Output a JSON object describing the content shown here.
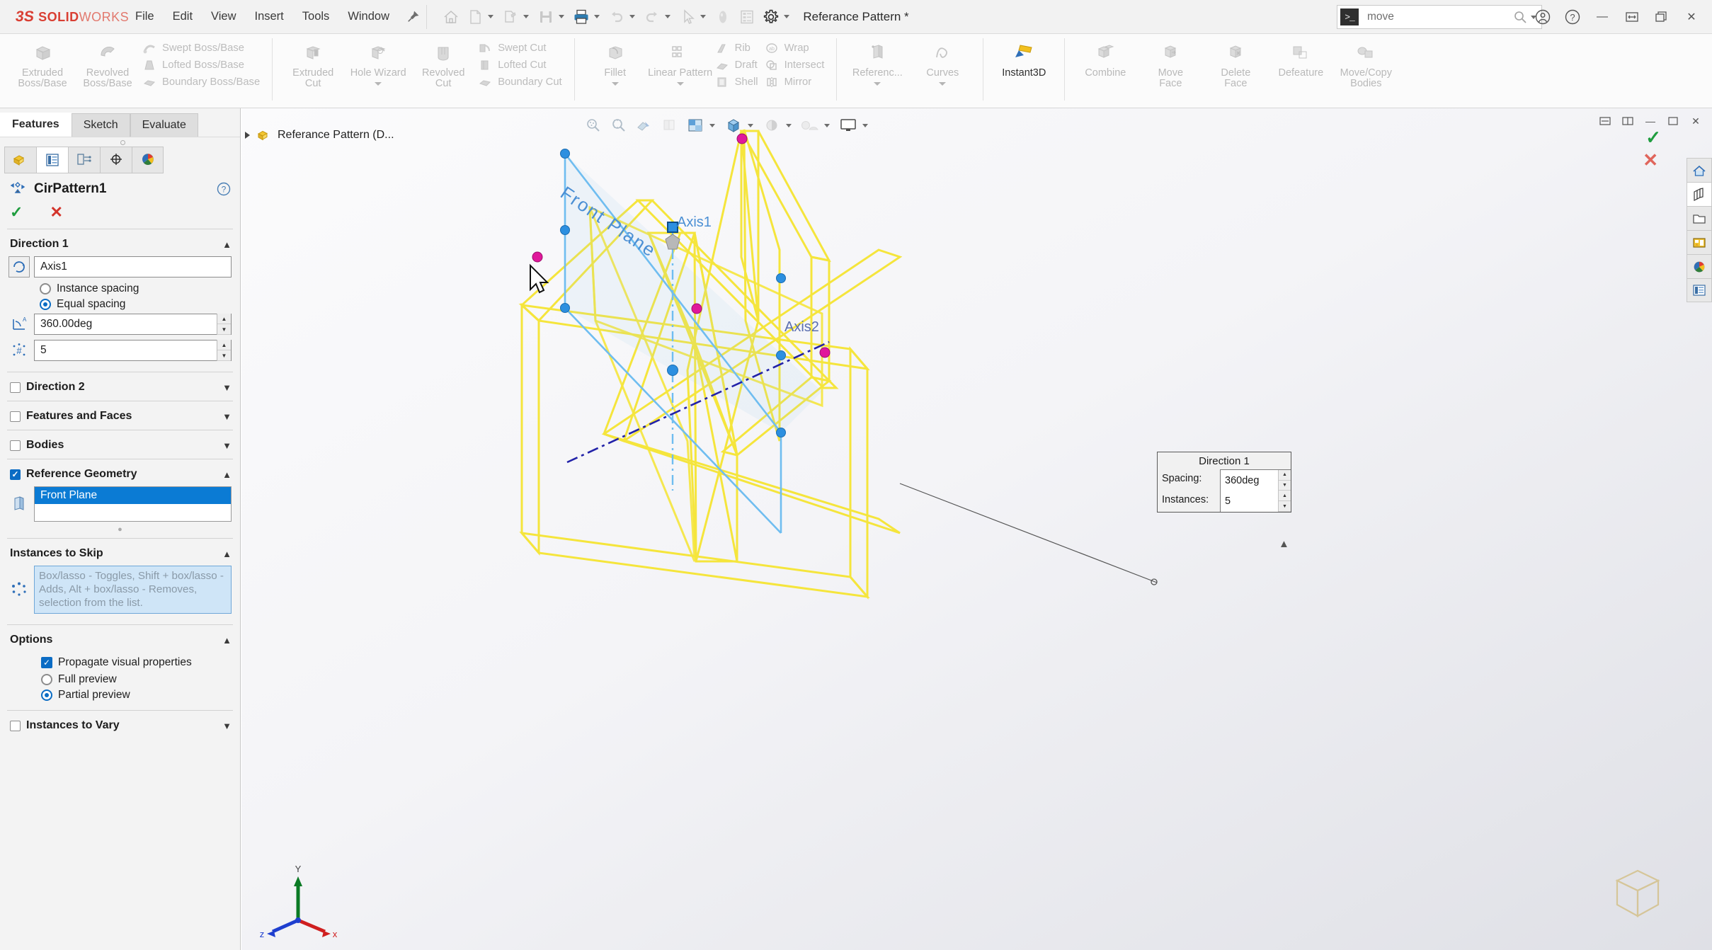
{
  "app": {
    "brand_ds": "3S",
    "brand_solid": "SOLID",
    "brand_works": "WORKS",
    "document_title": "Referance Pattern *"
  },
  "menu": {
    "items": [
      "File",
      "Edit",
      "View",
      "Insert",
      "Tools",
      "Window"
    ],
    "pin_icon": "pin-icon"
  },
  "quick_access": {
    "buttons": [
      {
        "name": "home-icon",
        "label": "Home"
      },
      {
        "name": "new-document-icon",
        "label": "New"
      },
      {
        "name": "open-document-icon",
        "label": "Open"
      },
      {
        "name": "save-icon",
        "label": "Save"
      },
      {
        "name": "print-icon",
        "label": "Print"
      },
      {
        "name": "undo-icon",
        "label": "Undo"
      },
      {
        "name": "redo-icon",
        "label": "Redo"
      },
      {
        "name": "select-arrow-icon",
        "label": "Select"
      },
      {
        "name": "rebuild-icon",
        "label": "Rebuild"
      },
      {
        "name": "file-properties-icon",
        "label": "File Properties"
      },
      {
        "name": "options-gear-icon",
        "label": "Options"
      }
    ]
  },
  "search": {
    "value": "move",
    "placeholder": "Search",
    "badge": ">_",
    "icon": "search-icon"
  },
  "window_controls": {
    "account_icon": "account-icon",
    "help_icon": "help-icon",
    "minimize": "—",
    "restore_icon": "restore-window-icon",
    "maximize_icon": "maximize-window-icon",
    "close": "✕"
  },
  "ribbon": {
    "groups": [
      {
        "big": [
          {
            "label": "Extruded\nBoss/Base",
            "icon": "extruded-boss-base-icon",
            "enabled": false
          },
          {
            "label": "Revolved\nBoss/Base",
            "icon": "revolved-boss-base-icon",
            "enabled": false
          }
        ],
        "small": [
          {
            "label": "Swept Boss/Base",
            "icon": "swept-boss-base-icon"
          },
          {
            "label": "Lofted Boss/Base",
            "icon": "lofted-boss-base-icon"
          },
          {
            "label": "Boundary Boss/Base",
            "icon": "boundary-boss-base-icon"
          }
        ]
      },
      {
        "big": [
          {
            "label": "Extruded\nCut",
            "icon": "extruded-cut-icon",
            "enabled": false,
            "dropdown": false
          },
          {
            "label": "Hole Wizard",
            "icon": "hole-wizard-icon",
            "enabled": false,
            "dropdown": true
          },
          {
            "label": "Revolved\nCut",
            "icon": "revolved-cut-icon",
            "enabled": false
          }
        ],
        "small": [
          {
            "label": "Swept Cut",
            "icon": "swept-cut-icon"
          },
          {
            "label": "Lofted Cut",
            "icon": "lofted-cut-icon"
          },
          {
            "label": "Boundary Cut",
            "icon": "boundary-cut-icon"
          }
        ]
      },
      {
        "big": [
          {
            "label": "Fillet",
            "icon": "fillet-icon",
            "enabled": false,
            "dropdown": true
          },
          {
            "label": "Linear Pattern",
            "icon": "linear-pattern-icon",
            "enabled": false,
            "dropdown": true
          }
        ],
        "small": [
          {
            "label": "Rib",
            "icon": "rib-icon"
          },
          {
            "label": "Draft",
            "icon": "draft-icon"
          },
          {
            "label": "Shell",
            "icon": "shell-icon"
          }
        ],
        "small2": [
          {
            "label": "Wrap",
            "icon": "wrap-icon"
          },
          {
            "label": "Intersect",
            "icon": "intersect-icon"
          },
          {
            "label": "Mirror",
            "icon": "mirror-icon"
          }
        ]
      },
      {
        "big": [
          {
            "label": "Referenc...",
            "icon": "reference-geometry-icon",
            "enabled": false,
            "dropdown": true
          },
          {
            "label": "Curves",
            "icon": "curves-icon",
            "enabled": false,
            "dropdown": true
          }
        ]
      },
      {
        "big": [
          {
            "label": "Instant3D",
            "icon": "instant3d-icon",
            "enabled": true
          }
        ]
      },
      {
        "big": [
          {
            "label": "Combine",
            "icon": "combine-icon",
            "enabled": false
          },
          {
            "label": "Move\nFace",
            "icon": "move-face-icon",
            "enabled": false
          },
          {
            "label": "Delete\nFace",
            "icon": "delete-face-icon",
            "enabled": false
          },
          {
            "label": "Defeature",
            "icon": "defeature-icon",
            "enabled": false
          },
          {
            "label": "Move/Copy\nBodies",
            "icon": "move-copy-bodies-icon",
            "enabled": false
          }
        ]
      }
    ],
    "collapse_chevron": "⌃"
  },
  "command_manager": {
    "tabs": [
      {
        "label": "Features",
        "active": true
      },
      {
        "label": "Sketch",
        "active": false
      },
      {
        "label": "Evaluate",
        "active": false
      }
    ]
  },
  "property_manager": {
    "tabs": [
      {
        "name": "feature-manager-tab",
        "icon": "feature-tree-icon",
        "active": false
      },
      {
        "name": "property-manager-tab",
        "icon": "property-manager-icon",
        "active": true
      },
      {
        "name": "configuration-manager-tab",
        "icon": "configuration-manager-icon",
        "active": false
      },
      {
        "name": "dimxpert-manager-tab",
        "icon": "dimxpert-icon",
        "active": false
      },
      {
        "name": "display-manager-tab",
        "icon": "display-manager-icon",
        "active": false
      }
    ],
    "title": "CirPattern1",
    "title_icon": "circular-pattern-icon",
    "help_icon": "help-icon",
    "ok_glyph": "✓",
    "cancel_glyph": "✕",
    "sections": {
      "direction1": {
        "header": "Direction 1",
        "axis_icon": "rotation-axis-icon",
        "axis_value": "Axis1",
        "spacing_mode": [
          {
            "label": "Instance spacing",
            "selected": false
          },
          {
            "label": "Equal spacing",
            "selected": true
          }
        ],
        "angle_icon": "angle-icon",
        "angle_value": "360.00deg",
        "instances_icon": "instance-count-icon",
        "instances_value": "5"
      },
      "direction2": {
        "header": "Direction 2",
        "checked": false,
        "expanded": false
      },
      "features_and_faces": {
        "header": "Features and Faces",
        "checked": false,
        "expanded": false
      },
      "bodies": {
        "header": "Bodies",
        "checked": false,
        "expanded": false
      },
      "reference_geometry": {
        "header": "Reference Geometry",
        "checked": true,
        "expanded": true,
        "item_icon": "plane-icon",
        "selected_item": "Front Plane"
      },
      "instances_to_skip": {
        "header": "Instances to Skip",
        "icon": "instances-to-skip-icon",
        "hint": "Box/lasso - Toggles, Shift + box/lasso - Adds, Alt + box/lasso - Removes, selection from the list."
      },
      "options": {
        "header": "Options",
        "propagate": {
          "label": "Propagate visual properties",
          "checked": true
        },
        "preview": [
          {
            "label": "Full preview",
            "selected": false
          },
          {
            "label": "Partial preview",
            "selected": true
          }
        ]
      },
      "instances_to_vary": {
        "header": "Instances to Vary",
        "checked": false,
        "expanded": false
      }
    }
  },
  "viewport": {
    "feature_tree_root": "Referance Pattern (D...",
    "feature_tree_icon": "part-icon",
    "confirm_check": "✓",
    "confirm_x": "✕",
    "toolbar": [
      {
        "name": "zoom-to-fit-icon"
      },
      {
        "name": "zoom-to-area-icon"
      },
      {
        "name": "section-view-icon"
      },
      {
        "name": "view-orientation-icon"
      },
      {
        "name": "display-style-icon",
        "dropdown": true
      },
      {
        "name": "hide-show-items-icon",
        "dropdown": true
      },
      {
        "name": "edit-appearance-icon",
        "dropdown": true
      },
      {
        "name": "apply-scene-icon",
        "dropdown": true
      },
      {
        "name": "view-settings-icon",
        "dropdown": true
      }
    ],
    "labels": {
      "front_plane": "Front Plane",
      "axis1": "Axis1",
      "axis2": "Axis2"
    },
    "callout": {
      "title": "Direction 1",
      "spacing_label": "Spacing:",
      "spacing_value": "360deg",
      "instances_label": "Instances:",
      "instances_value": "5"
    },
    "triad": {
      "x": "x",
      "y": "Y",
      "z": "z"
    },
    "colors": {
      "plane_yellow": "#f5e53c",
      "plane_blue": "#6fbdf0",
      "point_magenta": "#e0189b",
      "point_blue": "#2c8fe0",
      "axis_navy": "#2222a8",
      "label_blue": "#5b6fb0"
    }
  },
  "task_pane": {
    "buttons": [
      {
        "name": "sw-resources-icon",
        "active": false
      },
      {
        "name": "design-library-icon",
        "active": true
      },
      {
        "name": "file-explorer-icon",
        "active": false
      },
      {
        "name": "view-palette-icon",
        "active": false
      },
      {
        "name": "appearances-scenes-icon",
        "active": false
      },
      {
        "name": "custom-properties-icon",
        "active": false
      }
    ]
  }
}
